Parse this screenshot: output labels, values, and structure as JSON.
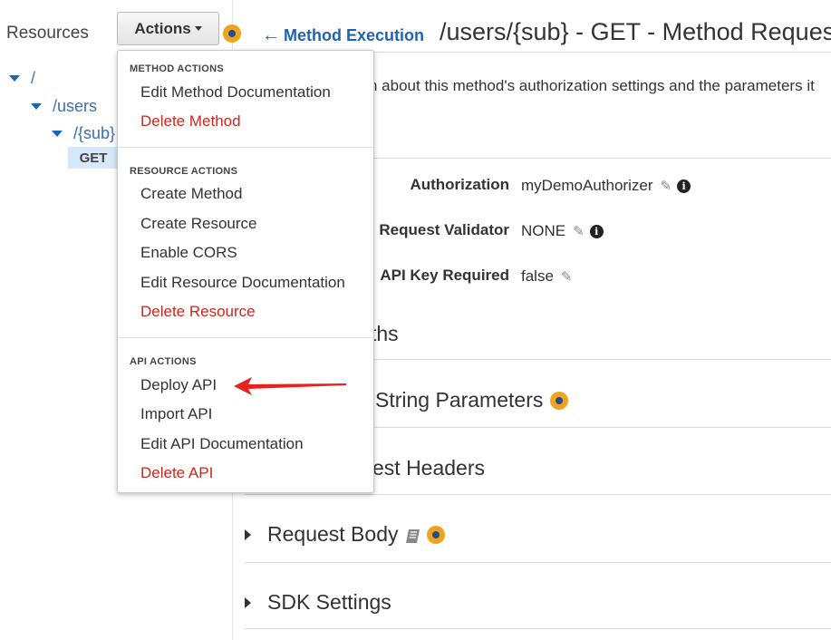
{
  "sidebar": {
    "title": "Resources",
    "tree": [
      {
        "label": "/"
      },
      {
        "label": "/users"
      },
      {
        "label": "/{sub}"
      }
    ],
    "selected_method": "GET"
  },
  "actions": {
    "label": "Actions"
  },
  "header": {
    "back_link": "Method Execution",
    "title": "/users/{sub} - GET - Method Request"
  },
  "description": "n about this method's authorization settings and the parameters it",
  "settings": {
    "authorization": {
      "label": "Authorization",
      "value": "myDemoAuthorizer"
    },
    "validator": {
      "label": "Request Validator",
      "value": "NONE"
    },
    "api_key": {
      "label": "API Key Required",
      "value": "false"
    }
  },
  "sections": {
    "paths": "ths",
    "query": "String Parameters",
    "headers": "est Headers",
    "body": "Request Body",
    "sdk": "SDK Settings"
  },
  "menu": {
    "method_header": "METHOD ACTIONS",
    "method_items": [
      {
        "label": "Edit Method Documentation"
      },
      {
        "label": "Delete Method"
      }
    ],
    "resource_header": "RESOURCE ACTIONS",
    "resource_items": [
      {
        "label": "Create Method"
      },
      {
        "label": "Create Resource"
      },
      {
        "label": "Enable CORS"
      },
      {
        "label": "Edit Resource Documentation"
      },
      {
        "label": "Delete Resource"
      }
    ],
    "api_header": "API ACTIONS",
    "api_items": [
      {
        "label": "Deploy API"
      },
      {
        "label": "Import API"
      },
      {
        "label": "Edit API Documentation"
      },
      {
        "label": "Delete API"
      }
    ]
  },
  "colors": {
    "link": "#1f63b5",
    "danger": "#d0261c",
    "help_badge": "#f1a21e",
    "annotation_arrow": "#e8211c"
  },
  "icons": {
    "back": "arrow-left-icon",
    "edit": "pencil-icon",
    "info": "info-icon",
    "help": "help-badge-icon",
    "docs": "book-icon"
  }
}
